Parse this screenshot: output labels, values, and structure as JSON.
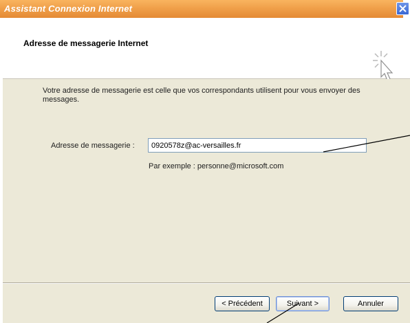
{
  "window": {
    "title": "Assistant Connexion Internet"
  },
  "header": {
    "title": "Adresse de messagerie Internet",
    "icon": "wizard-cursor-sparkle-icon"
  },
  "body": {
    "description": "Votre adresse de messagerie est celle que vos correspondants utilisent pour vous envoyer des messages.",
    "email_label": "Adresse de messagerie :",
    "email_value": "0920578z@ac-versailles.fr",
    "example": "Par exemple : personne@microsoft.com"
  },
  "footer": {
    "prev_label": "< Précédent",
    "next_label": "Suivant >",
    "cancel_label": "Annuler"
  },
  "colors": {
    "titlebar": "#f0a04a",
    "panel": "#ece9d8",
    "close": "#3a68d4"
  }
}
